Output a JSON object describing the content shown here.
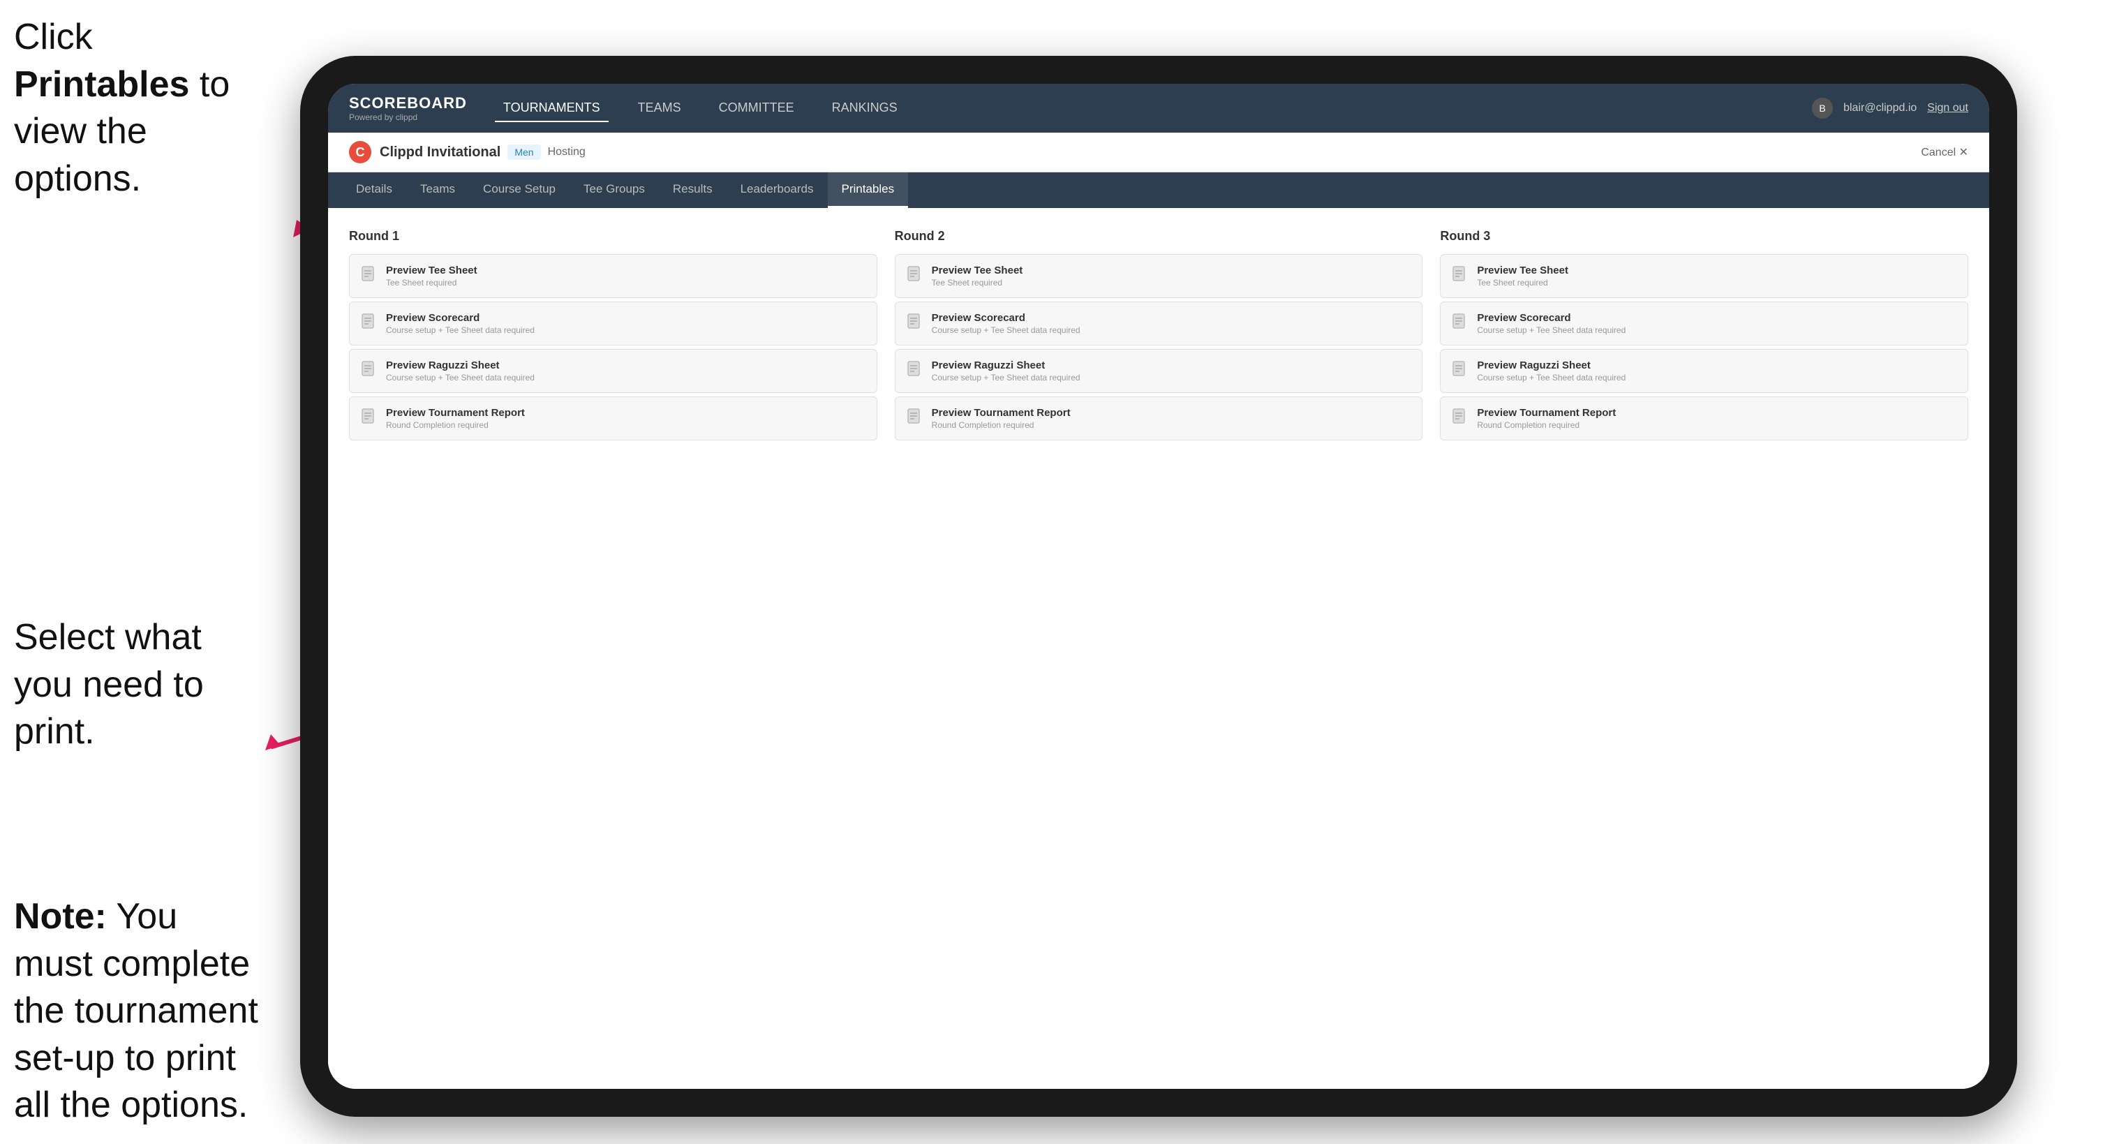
{
  "annotations": {
    "top": {
      "prefix": "Click ",
      "bold": "Printables",
      "suffix": " to view the options."
    },
    "mid": {
      "text": "Select what you need to print."
    },
    "bottom": {
      "bold": "Note:",
      "text": " You must complete the tournament set-up to print all the options."
    }
  },
  "nav": {
    "brand": {
      "title": "SCOREBOARD",
      "sub": "Powered by clippd"
    },
    "links": [
      "TOURNAMENTS",
      "TEAMS",
      "COMMITTEE",
      "RANKINGS"
    ],
    "active_link": "TOURNAMENTS",
    "user_email": "blair@clippd.io",
    "sign_out": "Sign out"
  },
  "tournament_bar": {
    "logo_letter": "C",
    "name": "Clippd Invitational",
    "badge": "Men",
    "hosting": "Hosting",
    "cancel": "Cancel ✕"
  },
  "sub_tabs": {
    "items": [
      "Details",
      "Teams",
      "Course Setup",
      "Tee Groups",
      "Results",
      "Leaderboards",
      "Printables"
    ],
    "active": "Printables"
  },
  "rounds": [
    {
      "title": "Round 1",
      "cards": [
        {
          "title": "Preview Tee Sheet",
          "sub": "Tee Sheet required"
        },
        {
          "title": "Preview Scorecard",
          "sub": "Course setup + Tee Sheet data required"
        },
        {
          "title": "Preview Raguzzi Sheet",
          "sub": "Course setup + Tee Sheet data required"
        },
        {
          "title": "Preview Tournament Report",
          "sub": "Round Completion required"
        }
      ]
    },
    {
      "title": "Round 2",
      "cards": [
        {
          "title": "Preview Tee Sheet",
          "sub": "Tee Sheet required"
        },
        {
          "title": "Preview Scorecard",
          "sub": "Course setup + Tee Sheet data required"
        },
        {
          "title": "Preview Raguzzi Sheet",
          "sub": "Course setup + Tee Sheet data required"
        },
        {
          "title": "Preview Tournament Report",
          "sub": "Round Completion required"
        }
      ]
    },
    {
      "title": "Round 3",
      "cards": [
        {
          "title": "Preview Tee Sheet",
          "sub": "Tee Sheet required"
        },
        {
          "title": "Preview Scorecard",
          "sub": "Course setup + Tee Sheet data required"
        },
        {
          "title": "Preview Raguzzi Sheet",
          "sub": "Course setup + Tee Sheet data required"
        },
        {
          "title": "Preview Tournament Report",
          "sub": "Round Completion required"
        }
      ]
    }
  ]
}
